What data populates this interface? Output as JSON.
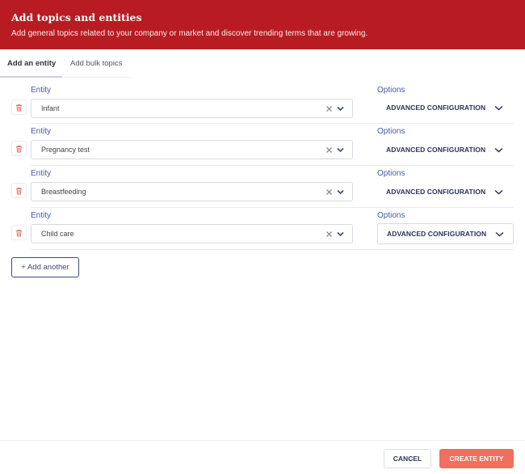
{
  "header": {
    "title": "Add topics and entities",
    "subtitle": "Add general topics related to your company or market and discover trending terms that are growing."
  },
  "tabs": [
    {
      "label": "Add an entity",
      "active": true
    },
    {
      "label": "Add bulk topics",
      "active": false
    }
  ],
  "rows": [
    {
      "entity_label": "Entity",
      "entity_value": "Infant",
      "options_label": "Options",
      "options_button": "ADVANCED CONFIGURATION"
    },
    {
      "entity_label": "Entity",
      "entity_value": "Pregnancy test",
      "options_label": "Options",
      "options_button": "ADVANCED CONFIGURATION"
    },
    {
      "entity_label": "Entity",
      "entity_value": "Breastfeeding",
      "options_label": "Options",
      "options_button": "ADVANCED CONFIGURATION"
    },
    {
      "entity_label": "Entity",
      "entity_value": "Child care",
      "options_label": "Options",
      "options_button": "ADVANCED CONFIGURATION"
    }
  ],
  "add_another_label": "+ Add another",
  "footer": {
    "cancel_label": "CANCEL",
    "create_label": "CREATE ENTITY"
  },
  "colors": {
    "header_bg": "#b81c22",
    "accent": "#4a5a9e",
    "primary_button": "#f26e5e",
    "delete_icon": "#e8716b"
  },
  "icons": {
    "delete": "trash-icon",
    "clear": "close-icon",
    "dropdown": "chevron-down-icon"
  }
}
